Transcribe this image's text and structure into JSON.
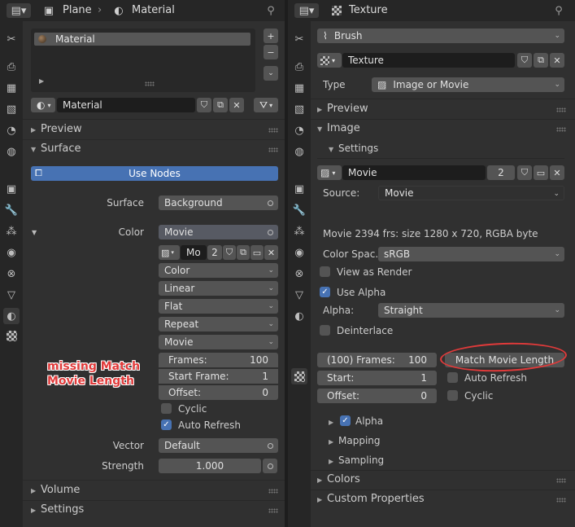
{
  "left": {
    "header": {
      "object_name": "Plane",
      "context_label": "Material"
    },
    "material_slots": [
      {
        "label": "Material"
      }
    ],
    "material_field": "Material",
    "sections": {
      "preview": "Preview",
      "surface": "Surface",
      "volume": "Volume",
      "settings": "Settings"
    },
    "use_nodes": "Use Nodes",
    "surface_label": "Surface",
    "surface_value": "Background",
    "color_label": "Color",
    "color_value": "Movie",
    "image_name": "Mo",
    "image_users": "2",
    "dropdowns": [
      "Color",
      "Linear",
      "Flat",
      "Repeat",
      "Movie"
    ],
    "frames_label": "Frames:",
    "frames_value": "100",
    "start_label": "Start Frame:",
    "start_value": "1",
    "offset_label": "Offset:",
    "offset_value": "0",
    "cyclic": "Cyclic",
    "auto_refresh": "Auto Refresh",
    "vector_label": "Vector",
    "vector_value": "Default",
    "strength_label": "Strength",
    "strength_value": "1.000",
    "annotation": [
      "missing Match",
      "Movie Length"
    ]
  },
  "right": {
    "header": {
      "context_label": "Texture"
    },
    "brush": "Brush",
    "texture_field": "Texture",
    "type_label": "Type",
    "type_value": "Image or Movie",
    "sections": {
      "preview": "Preview",
      "image": "Image",
      "settings": "Settings",
      "colors": "Colors",
      "custom": "Custom Properties",
      "alpha": "Alpha",
      "mapping": "Mapping",
      "sampling": "Sampling"
    },
    "image_name": "Movie",
    "image_users": "2",
    "source_label": "Source:",
    "source_value": "Movie",
    "info": "Movie 2394 frs: size 1280 x 720, RGBA byte",
    "colorspace_label": "Color Spac..",
    "colorspace_value": "sRGB",
    "view_as_render": "View as Render",
    "use_alpha": "Use Alpha",
    "alpha_label": "Alpha:",
    "alpha_value": "Straight",
    "deinterlace": "Deinterlace",
    "frames_label": "(100) Frames:",
    "frames_value": "100",
    "match_button": "Match Movie Length",
    "start_label": "Start:",
    "start_value": "1",
    "auto_refresh": "Auto Refresh",
    "offset_label": "Offset:",
    "offset_value": "0",
    "cyclic": "Cyclic"
  },
  "colors": {
    "accent": "#4772b3",
    "annotation": "#e03a3a"
  }
}
